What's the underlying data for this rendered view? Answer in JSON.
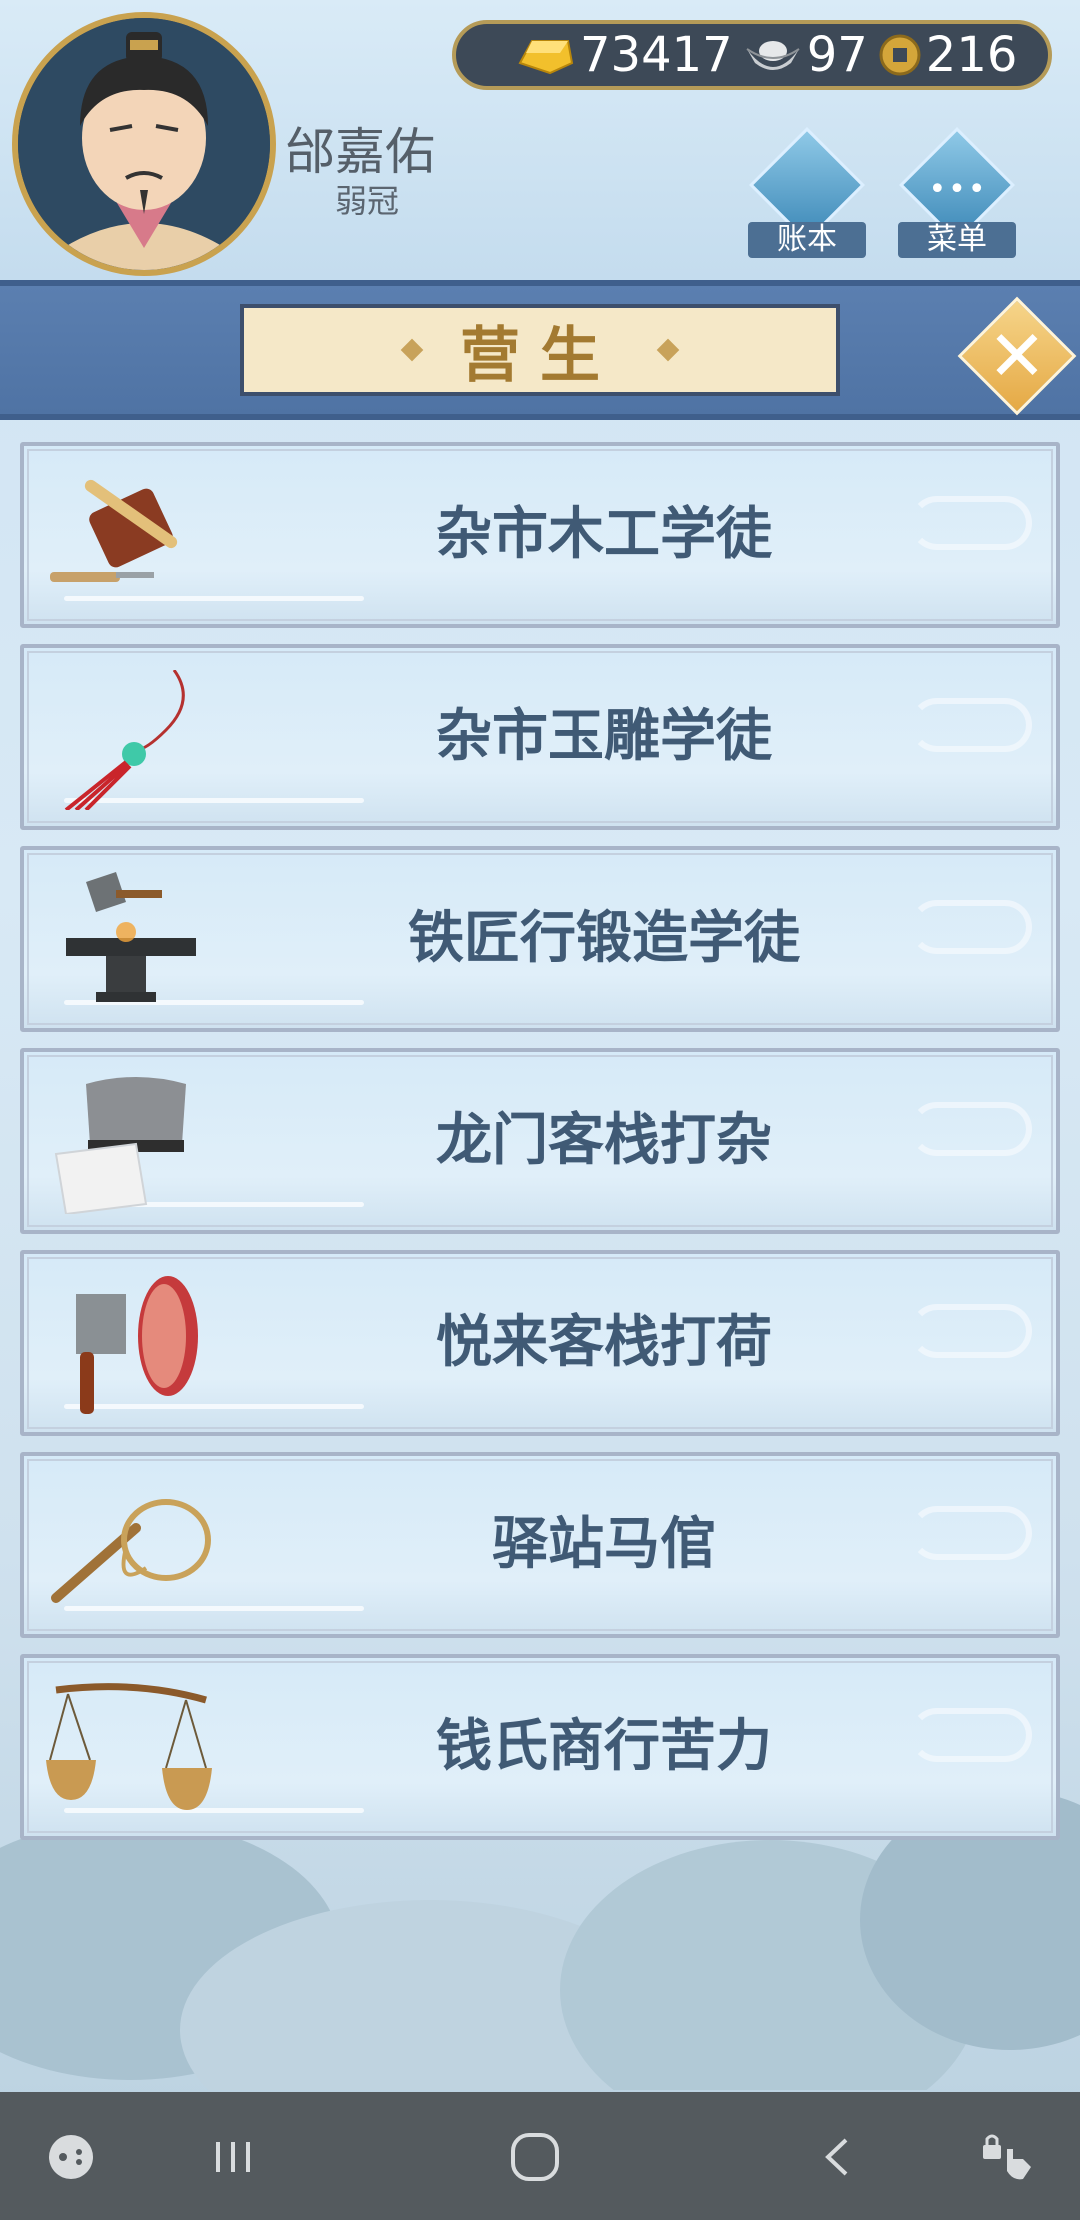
{
  "player": {
    "name": "邰嘉佑",
    "title": "弱冠"
  },
  "currency": {
    "gold": "73417",
    "silver": "97",
    "coin": "216"
  },
  "header_buttons": {
    "ledger": "账本",
    "menu": "菜单"
  },
  "page_title": "营生",
  "jobs": [
    {
      "label": "杂市木工学徒",
      "icon": "woodworking-plane-icon"
    },
    {
      "label": "杂市玉雕学徒",
      "icon": "jade-pendant-icon"
    },
    {
      "label": "铁匠行锻造学徒",
      "icon": "anvil-hammer-icon"
    },
    {
      "label": "龙门客栈打杂",
      "icon": "chef-hat-towel-icon"
    },
    {
      "label": "悦来客栈打荷",
      "icon": "cleaver-meat-icon"
    },
    {
      "label": "驿站马倌",
      "icon": "whip-icon"
    },
    {
      "label": "钱氏商行苦力",
      "icon": "carrying-pole-baskets-icon"
    }
  ],
  "colors": {
    "accent_blue": "#4f73a4",
    "gold": "#c9a24f",
    "text": "#405a75"
  }
}
